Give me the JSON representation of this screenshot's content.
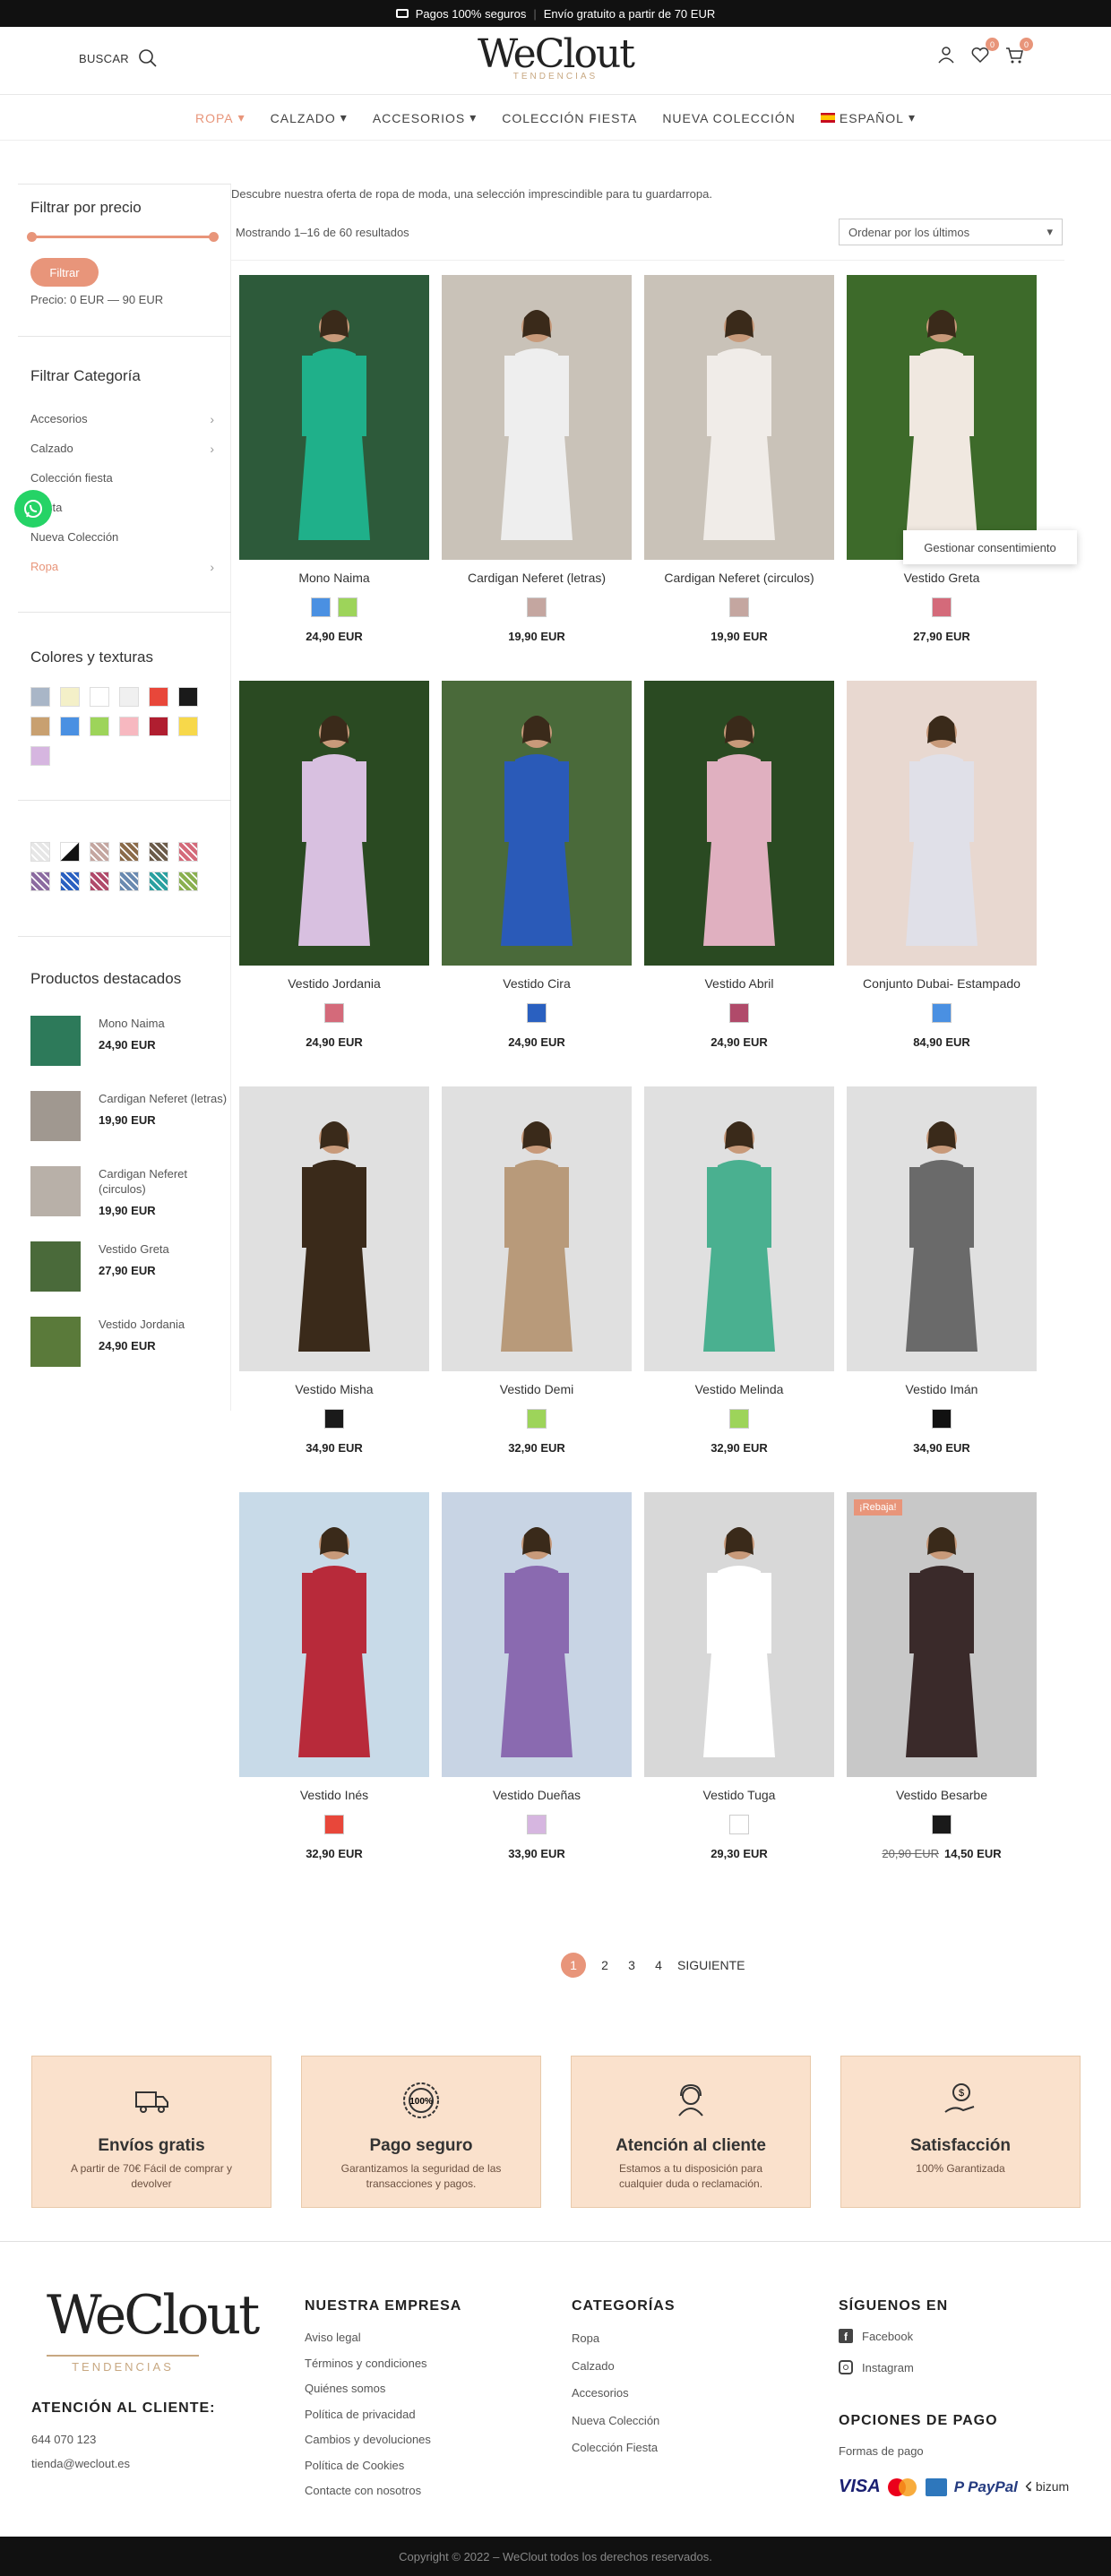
{
  "topbar": {
    "left": "Pagos 100% seguros",
    "right": "Envío gratuito a partir de 70 EUR"
  },
  "header": {
    "search": "BUSCAR",
    "logo": "WeClout",
    "logo_sub": "TENDENCIAS",
    "wishlist_count": "0",
    "cart_count": "0"
  },
  "nav": [
    {
      "label": "ROPA"
    },
    {
      "label": "CALZADO"
    },
    {
      "label": "ACCESORIOS"
    },
    {
      "label": "COLECCIÓN FIESTA"
    },
    {
      "label": "NUEVA COLECCIÓN"
    },
    {
      "label": "ESPAÑOL"
    }
  ],
  "sidebar": {
    "price_title": "Filtrar por precio",
    "filter_btn": "Filtrar",
    "price_range": "Precio: 0 EUR — 90 EUR",
    "cat_title": "Filtrar Categoría",
    "categories": [
      "Accesorios",
      "Calzado",
      "Colección fiesta",
      "Fiesta",
      "Nueva Colección",
      "Ropa"
    ],
    "colors_title": "Colores y texturas",
    "colors": [
      "#a9b6c7",
      "#f4f0c8",
      "#ffffff",
      "#f0f0f0",
      "#e8473a",
      "#1a1a1a",
      "#c8a070",
      "#4a90e2",
      "#9dd45a",
      "#f7b8c0",
      "#b01e30",
      "#f7d84a",
      "#d6b6e0"
    ],
    "textures": [
      "#e6e6e6",
      "#111111",
      "#c4a6a0",
      "#8b6b4a",
      "#6b5b4a",
      "#d46a7a",
      "#8b6ba0",
      "#2a60c0",
      "#b04a6a",
      "#6a8ab0",
      "#2aa0a0",
      "#8ab050"
    ],
    "featured_title": "Productos destacados",
    "featured": [
      {
        "name": "Mono Naima",
        "price": "24,90 EUR"
      },
      {
        "name": "Cardigan Neferet (letras)",
        "price": "19,90 EUR"
      },
      {
        "name": "Cardigan Neferet (circulos)",
        "price": "19,90 EUR"
      },
      {
        "name": "Vestido Greta",
        "price": "27,90 EUR"
      },
      {
        "name": "Vestido Jordania",
        "price": "24,90 EUR"
      }
    ]
  },
  "shop": {
    "intro": "Descubre nuestra oferta de ropa de moda, una selección imprescindible para tu guardarropa.",
    "count": "Mostrando 1–16 de 60 resultados",
    "order": "Ordenar por los últimos",
    "consent": "Gestionar consentimiento",
    "sale_badge": "¡Rebaja!"
  },
  "products": [
    {
      "name": "Mono Naima",
      "price": "24,90 EUR",
      "colors": [
        "#4a90e2",
        "#9dd45a"
      ],
      "bg": "#2d5a3a",
      "dress": "#1fb08a"
    },
    {
      "name": "Cardigan Neferet (letras)",
      "price": "19,90 EUR",
      "colors": [
        "#c4a6a0"
      ],
      "bg": "#c9c2b8",
      "dress": "#eeeeee"
    },
    {
      "name": "Cardigan Neferet (circulos)",
      "price": "19,90 EUR",
      "colors": [
        "#c4a6a0"
      ],
      "bg": "#c9c2b8",
      "dress": "#f0ece8"
    },
    {
      "name": "Vestido Greta",
      "price": "27,90 EUR",
      "colors": [
        "#d46a7a"
      ],
      "bg": "#3d6a2a",
      "dress": "#f0e8e0"
    },
    {
      "name": "Vestido Jordania",
      "price": "24,90 EUR",
      "colors": [
        "#d46a7a"
      ],
      "bg": "#2a4a22",
      "dress": "#d8c0e0"
    },
    {
      "name": "Vestido Cira",
      "price": "24,90 EUR",
      "colors": [
        "#2a60c0"
      ],
      "bg": "#4a6a3a",
      "dress": "#2a5ab8"
    },
    {
      "name": "Vestido Abril",
      "price": "24,90 EUR",
      "colors": [
        "#b04a6a"
      ],
      "bg": "#2a4a22",
      "dress": "#e0b0c0"
    },
    {
      "name": "Conjunto Dubai- Estampado",
      "price": "84,90 EUR",
      "colors": [
        "#4a90e2"
      ],
      "bg": "#e8d8d0",
      "dress": "#e0e0e8"
    },
    {
      "name": "Vestido Misha",
      "price": "34,90 EUR",
      "colors": [
        "#1a1a1a"
      ],
      "bg": "#e0e0e0",
      "dress": "#3a2a1a"
    },
    {
      "name": "Vestido Demi",
      "price": "32,90 EUR",
      "colors": [
        "#9dd45a"
      ],
      "bg": "#e0e0e0",
      "dress": "#b89a7a"
    },
    {
      "name": "Vestido Melinda",
      "price": "32,90 EUR",
      "colors": [
        "#9dd45a"
      ],
      "bg": "#e0e0e0",
      "dress": "#4ab090"
    },
    {
      "name": "Vestido Imán",
      "price": "34,90 EUR",
      "colors": [
        "#111111"
      ],
      "bg": "#e0e0e0",
      "dress": "#6a6a6a"
    },
    {
      "name": "Vestido Inés",
      "price": "32,90 EUR",
      "colors": [
        "#e8473a"
      ],
      "bg": "#c8dae8",
      "dress": "#b82a3a"
    },
    {
      "name": "Vestido Dueñas",
      "price": "33,90 EUR",
      "colors": [
        "#d6b6e0"
      ],
      "bg": "#c8d4e4",
      "dress": "#8a6ab0"
    },
    {
      "name": "Vestido Tuga",
      "price": "29,30 EUR",
      "colors": [
        "#ffffff"
      ],
      "bg": "#d8d8d8",
      "dress": "#ffffff"
    },
    {
      "name": "Vestido Besarbe",
      "price": "14,50 EUR",
      "old": "20,90 EUR",
      "colors": [
        "#1a1a1a"
      ],
      "bg": "#c8c8c8",
      "dress": "#3a2a2a",
      "sale": true
    }
  ],
  "pagination": {
    "pages": [
      "1",
      "2",
      "3",
      "4"
    ],
    "next": "SIGUIENTE"
  },
  "features": [
    {
      "title": "Envíos gratis",
      "desc": "A partir de 70€ Fácil de comprar y devolver"
    },
    {
      "title": "Pago seguro",
      "desc": "Garantizamos la seguridad de las transacciones y pagos."
    },
    {
      "title": "Atención al cliente",
      "desc": "Estamos a tu disposición para cualquier duda o reclamación."
    },
    {
      "title": "Satisfacción",
      "desc": "100% Garantizada"
    }
  ],
  "footer": {
    "attention": "ATENCIÓN AL CLIENTE:",
    "phone": "644 070 123",
    "email": "tienda@weclout.es",
    "company_title": "NUESTRA EMPRESA",
    "company": [
      "Aviso legal",
      "Términos y condiciones",
      "Quiénes somos",
      "Política de privacidad",
      "Cambios y devoluciones",
      "Política de Cookies",
      "Contacte con nosotros"
    ],
    "cat_title": "CATEGORÍAS",
    "cats": [
      "Ropa",
      "Calzado",
      "Accesorios",
      "Nueva Colección",
      "Colección Fiesta"
    ],
    "follow_title": "SÍGUENOS EN",
    "facebook": "Facebook",
    "instagram": "Instagram",
    "pay_title": "OPCIONES DE PAGO",
    "pay_sub": "Formas de pago",
    "visa": "VISA",
    "paypal": "PayPal",
    "bizum": "bizum",
    "copyright": "Copyright © 2022 – WeClout todos los derechos reservados."
  }
}
